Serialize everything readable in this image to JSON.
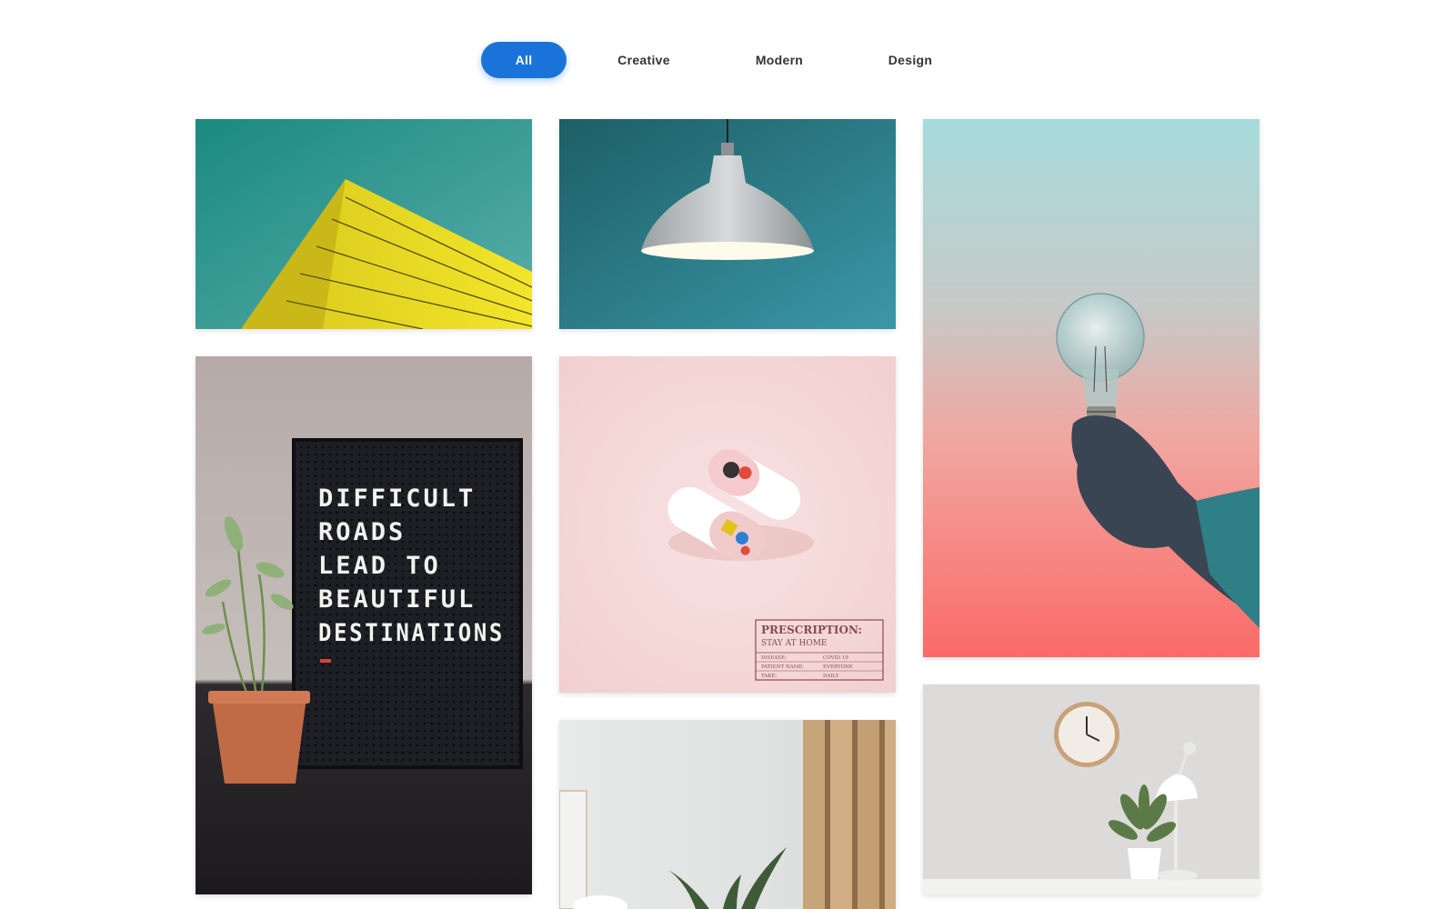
{
  "filters": {
    "items": [
      {
        "label": "All",
        "active": true
      },
      {
        "label": "Creative",
        "active": false
      },
      {
        "label": "Modern",
        "active": false
      },
      {
        "label": "Design",
        "active": false
      }
    ],
    "active_color": "#1a73d9"
  },
  "gallery": {
    "cards": [
      {
        "name": "yellow-building-photo"
      },
      {
        "name": "pendant-lamp-photo"
      },
      {
        "name": "light-bulb-hand-photo"
      },
      {
        "name": "letter-board-plant-photo",
        "board_lines": [
          "DIFFICULT",
          "ROADS",
          "LEAD TO",
          "BEAUTIFUL",
          "DESTINATIONS"
        ]
      },
      {
        "name": "pills-prescription-photo",
        "prescription": {
          "title": "PRESCRIPTION:",
          "subtitle": "STAY AT HOME",
          "rows": [
            {
              "label": "DISEASE:",
              "value": "COVID 19"
            },
            {
              "label": "PATIENT NAME:",
              "value": "EVERYONE"
            },
            {
              "label": "TAKE:",
              "value": "DAILY"
            }
          ]
        }
      },
      {
        "name": "wood-panel-plant-photo"
      },
      {
        "name": "clock-lamp-desk-photo"
      }
    ]
  }
}
